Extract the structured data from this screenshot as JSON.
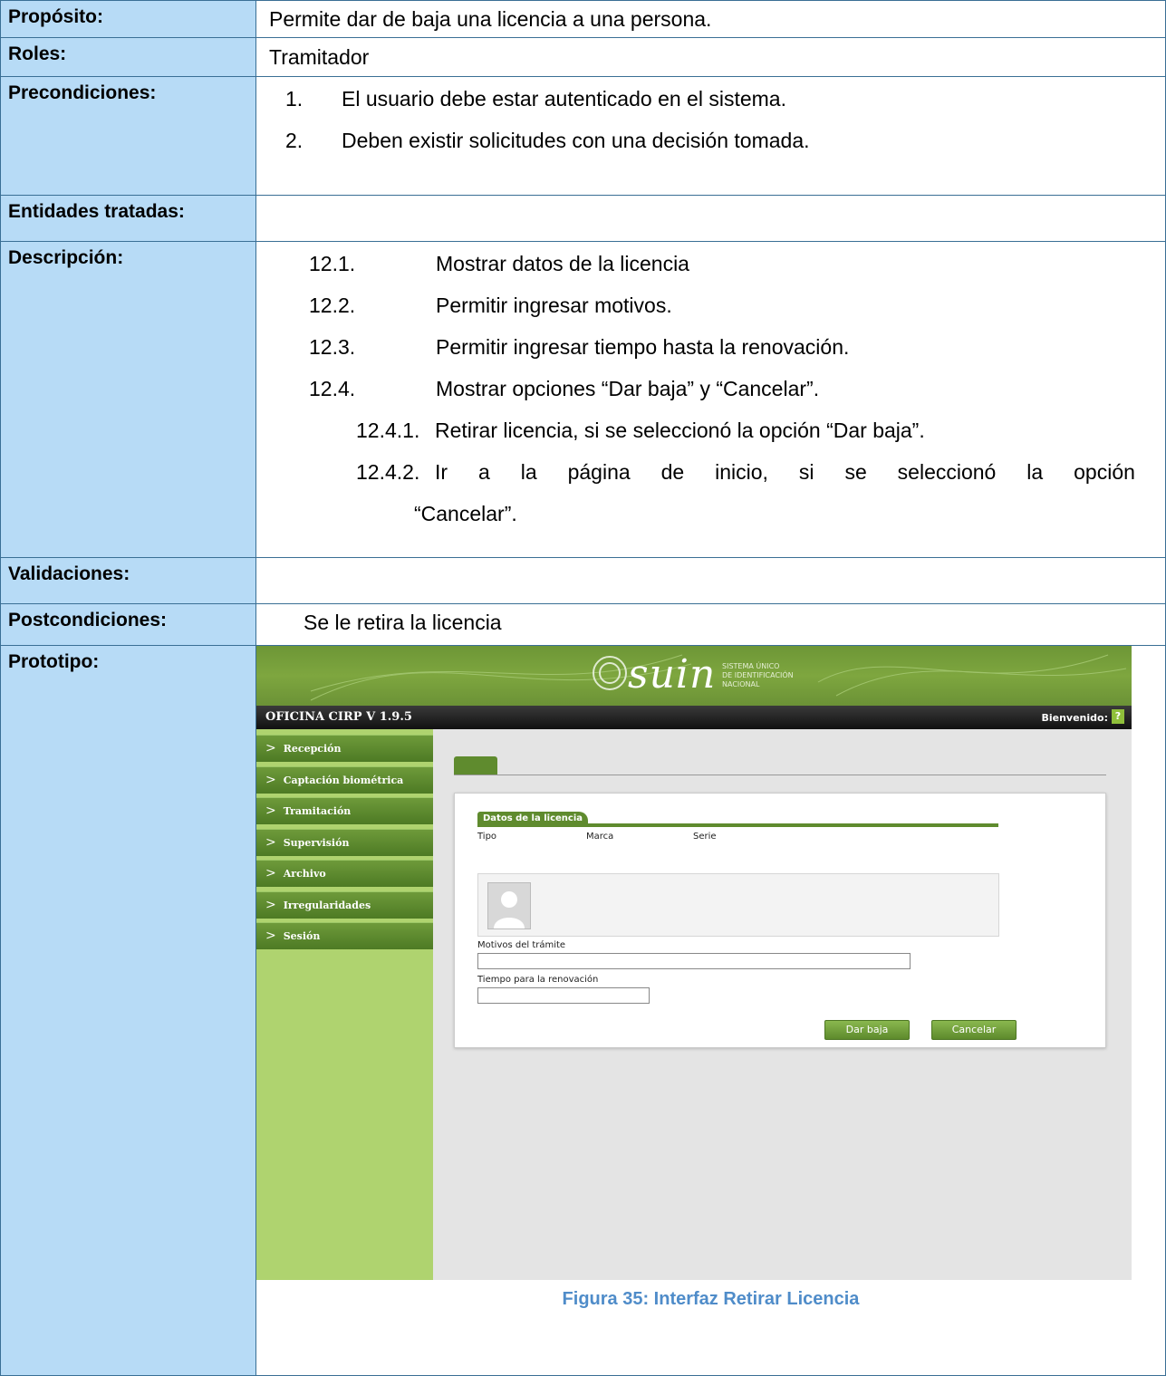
{
  "rows": {
    "proposito": {
      "label": "Propósito:",
      "value": "Permite dar de baja una licencia a una persona."
    },
    "roles": {
      "label": "Roles:",
      "value": "Tramitador"
    },
    "precondiciones": {
      "label": "Precondiciones:",
      "items": [
        {
          "num": "1.",
          "text": "El usuario debe estar autenticado en el sistema."
        },
        {
          "num": "2.",
          "text": "Deben existir solicitudes con una decisión tomada."
        }
      ]
    },
    "entidades": {
      "label": "Entidades tratadas:",
      "value": ""
    },
    "descripcion": {
      "label": "Descripción:",
      "items": [
        {
          "num": "12.1.",
          "text": "Mostrar datos de la licencia"
        },
        {
          "num": "12.2.",
          "text": "Permitir ingresar motivos."
        },
        {
          "num": "12.3.",
          "text": "Permitir ingresar tiempo hasta la renovación."
        },
        {
          "num": "12.4.",
          "text": "Mostrar opciones “Dar baja” y “Cancelar”."
        }
      ],
      "subitems": [
        {
          "num": "12.4.1.",
          "text": "Retirar licencia, si se seleccionó la opción “Dar baja”."
        },
        {
          "num": "12.4.2.",
          "text_words": [
            "Ir",
            "a",
            "la",
            "página",
            "de",
            "inicio,",
            "si",
            "se",
            "seleccionó",
            "la",
            "opción"
          ],
          "cont": "“Cancelar”."
        }
      ]
    },
    "validaciones": {
      "label": "Validaciones:",
      "value": ""
    },
    "postcondiciones": {
      "label": "Postcondiciones:",
      "value": "Se le retira la licencia"
    },
    "prototipo": {
      "label": "Prototipo:"
    }
  },
  "prototype": {
    "logo": "suin",
    "logo_sub": [
      "SISTEMA ÚNICO",
      "DE IDENTIFICACIÓN",
      "NACIONAL"
    ],
    "office": "OFICINA CIRP V 1.9.5",
    "welcome": "Bienvenido:",
    "help": "?",
    "menu": [
      "Recepción",
      "Captación biométrica",
      "Tramitación",
      "Supervisión",
      "Archivo",
      "Irregularidades",
      "Sesión"
    ],
    "section_title": "Datos de la licencia",
    "columns": [
      "Tipo",
      "Marca",
      "Serie"
    ],
    "motivos_label": "Motivos del trámite",
    "tiempo_label": "Tiempo para la renovación",
    "btn_baja": "Dar baja",
    "btn_cancelar": "Cancelar",
    "colors": {
      "green": "#5f8b2e",
      "sidebar": "#afd36f",
      "label_bg": "#b7dbf6"
    }
  },
  "caption": "Figura 35: Interfaz Retirar Licencia"
}
